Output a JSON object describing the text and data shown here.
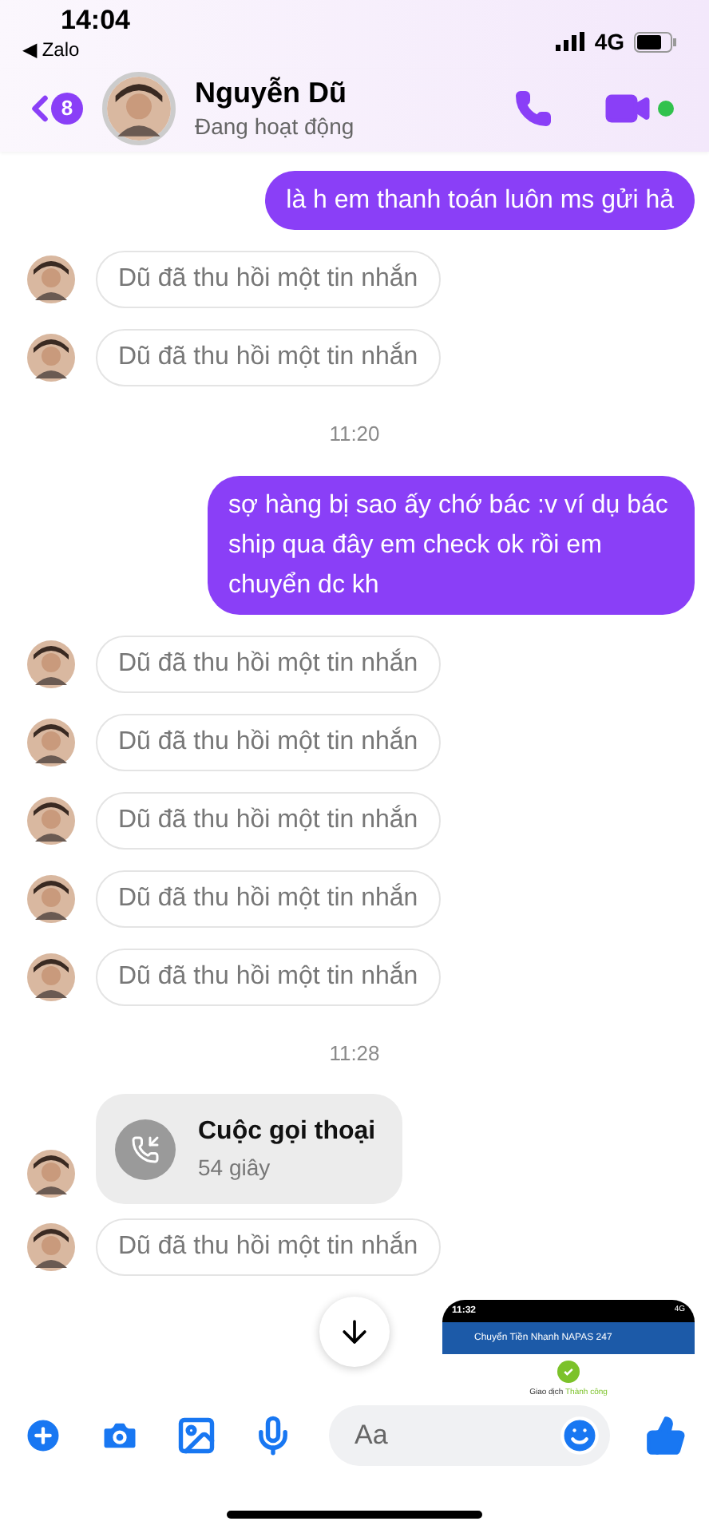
{
  "status_bar": {
    "time": "14:04",
    "back_app": "◀ Zalo",
    "network": "4G"
  },
  "header": {
    "badge": "8",
    "name": "Nguyễn Dũ",
    "status": "Đang hoạt động",
    "online": true
  },
  "messages": [
    {
      "kind": "sent",
      "text": "là h em thanh toán luôn ms gửi hả"
    },
    {
      "kind": "recalled",
      "text": "Dũ đã thu hồi một tin nhắn"
    },
    {
      "kind": "recalled",
      "text": "Dũ đã thu hồi một tin nhắn"
    },
    {
      "kind": "timestamp",
      "text": "11:20"
    },
    {
      "kind": "sent",
      "text": "sợ hàng bị sao ấy chớ bác :v ví dụ bác ship qua đây em check ok rồi em chuyển dc kh"
    },
    {
      "kind": "recalled",
      "text": "Dũ đã thu hồi một tin nhắn"
    },
    {
      "kind": "recalled",
      "text": "Dũ đã thu hồi một tin nhắn"
    },
    {
      "kind": "recalled",
      "text": "Dũ đã thu hồi một tin nhắn"
    },
    {
      "kind": "recalled",
      "text": "Dũ đã thu hồi một tin nhắn"
    },
    {
      "kind": "recalled",
      "text": "Dũ đã thu hồi một tin nhắn"
    },
    {
      "kind": "timestamp",
      "text": "11:28"
    },
    {
      "kind": "call",
      "title": "Cuộc gọi thoại",
      "duration": "54 giây"
    },
    {
      "kind": "recalled",
      "text": "Dũ đã thu hồi một tin nhắn"
    },
    {
      "kind": "image",
      "time": "11:32",
      "network": "4G",
      "bank_title": "Chuyển Tiền Nhanh NAPAS 247",
      "result_label": "Giao dịch",
      "result_value": "Thành công"
    }
  ],
  "composer": {
    "placeholder": "Aa"
  }
}
